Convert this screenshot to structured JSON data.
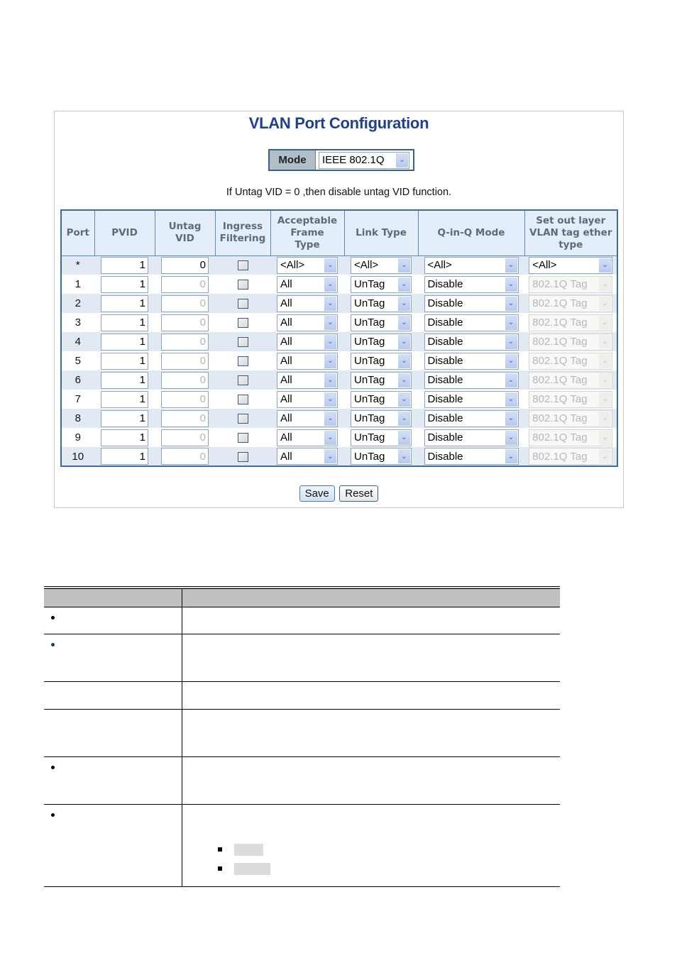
{
  "page": {
    "title": "VLAN Port Configuration",
    "mode": {
      "label": "Mode",
      "value": "IEEE 802.1Q"
    },
    "note": "If Untag VID = 0 ,then disable untag VID function."
  },
  "table": {
    "headers": [
      "Port",
      "PVID",
      "Untag VID",
      "Ingress Filtering",
      "Acceptable Frame Type",
      "Link Type",
      "Q-in-Q Mode",
      "Set out layer VLAN tag ether type"
    ],
    "header_lines": {
      "untag_vid": [
        "Untag",
        "VID"
      ],
      "ingress": [
        "Ingress",
        "Filtering"
      ],
      "acceptable": [
        "Acceptable",
        "Frame",
        "Type"
      ],
      "ether": [
        "Set out layer",
        "VLAN tag ether",
        "type"
      ]
    },
    "global_row": {
      "port": "*",
      "pvid": "1",
      "untag_vid": "0",
      "ingress_filtering": false,
      "frame_type": "<All>",
      "link_type": "<All>",
      "qinq_mode": "<All>",
      "ether_type": "<All>"
    },
    "rows": [
      {
        "port": "1",
        "pvid": "1",
        "untag_vid": "0",
        "ingress_filtering": false,
        "frame_type": "All",
        "link_type": "UnTag",
        "qinq_mode": "Disable",
        "ether_type": "802.1Q Tag"
      },
      {
        "port": "2",
        "pvid": "1",
        "untag_vid": "0",
        "ingress_filtering": false,
        "frame_type": "All",
        "link_type": "UnTag",
        "qinq_mode": "Disable",
        "ether_type": "802.1Q Tag"
      },
      {
        "port": "3",
        "pvid": "1",
        "untag_vid": "0",
        "ingress_filtering": false,
        "frame_type": "All",
        "link_type": "UnTag",
        "qinq_mode": "Disable",
        "ether_type": "802.1Q Tag"
      },
      {
        "port": "4",
        "pvid": "1",
        "untag_vid": "0",
        "ingress_filtering": false,
        "frame_type": "All",
        "link_type": "UnTag",
        "qinq_mode": "Disable",
        "ether_type": "802.1Q Tag"
      },
      {
        "port": "5",
        "pvid": "1",
        "untag_vid": "0",
        "ingress_filtering": false,
        "frame_type": "All",
        "link_type": "UnTag",
        "qinq_mode": "Disable",
        "ether_type": "802.1Q Tag"
      },
      {
        "port": "6",
        "pvid": "1",
        "untag_vid": "0",
        "ingress_filtering": false,
        "frame_type": "All",
        "link_type": "UnTag",
        "qinq_mode": "Disable",
        "ether_type": "802.1Q Tag"
      },
      {
        "port": "7",
        "pvid": "1",
        "untag_vid": "0",
        "ingress_filtering": false,
        "frame_type": "All",
        "link_type": "UnTag",
        "qinq_mode": "Disable",
        "ether_type": "802.1Q Tag"
      },
      {
        "port": "8",
        "pvid": "1",
        "untag_vid": "0",
        "ingress_filtering": false,
        "frame_type": "All",
        "link_type": "UnTag",
        "qinq_mode": "Disable",
        "ether_type": "802.1Q Tag"
      },
      {
        "port": "9",
        "pvid": "1",
        "untag_vid": "0",
        "ingress_filtering": false,
        "frame_type": "All",
        "link_type": "UnTag",
        "qinq_mode": "Disable",
        "ether_type": "802.1Q Tag"
      },
      {
        "port": "10",
        "pvid": "1",
        "untag_vid": "0",
        "ingress_filtering": false,
        "frame_type": "All",
        "link_type": "UnTag",
        "qinq_mode": "Disable",
        "ether_type": "802.1Q Tag"
      }
    ]
  },
  "buttons": {
    "save": "Save",
    "reset": "Reset"
  },
  "description_table": {
    "rows": [
      {
        "bullet": "black"
      },
      {
        "bullet": "blue"
      },
      {
        "bullet": "none"
      },
      {
        "bullet": "none"
      },
      {
        "bullet": "black"
      },
      {
        "bullet": "black",
        "sub_items": 2
      }
    ]
  },
  "icons": {
    "dropdown": "chevron-down-icon",
    "checkbox": "checkbox-icon",
    "bullet": "bullet-icon"
  }
}
